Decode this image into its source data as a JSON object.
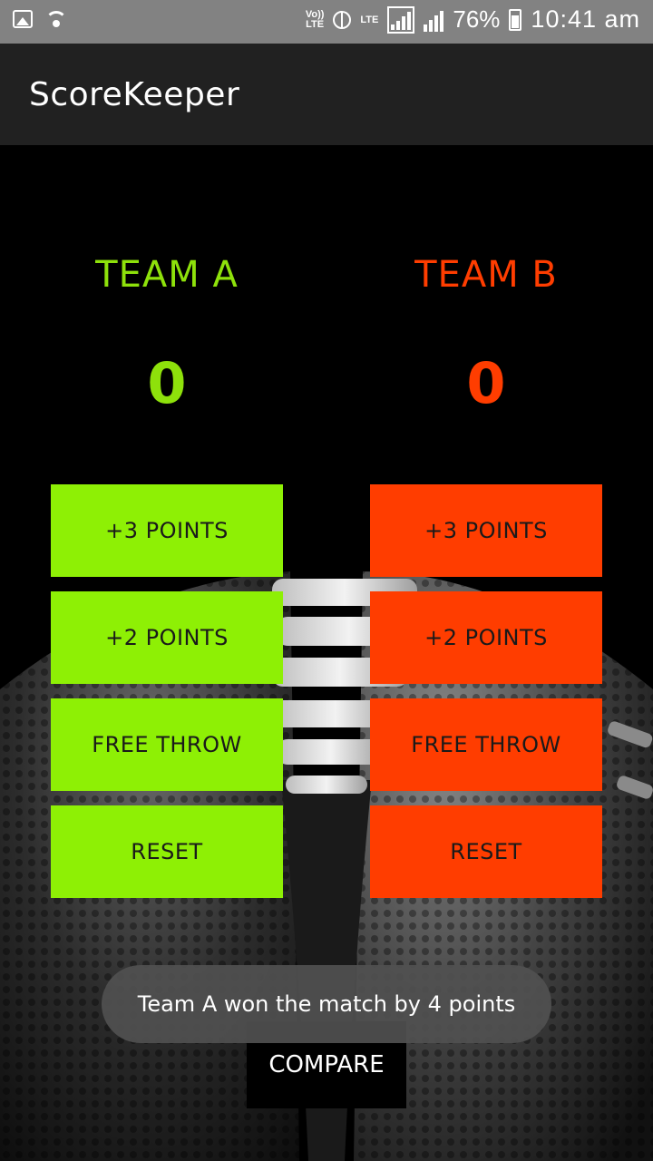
{
  "status_bar": {
    "volte_label": "Vo))\nLTE",
    "lte_label": "LTE",
    "battery_percent": "76%",
    "time": "10:41 am",
    "icons": [
      "image-icon",
      "wifi-icon",
      "volte-icon",
      "globe-icon",
      "lte-signal-icon",
      "signal-icon",
      "battery-icon"
    ]
  },
  "app_bar": {
    "title": "ScoreKeeper"
  },
  "team_a": {
    "name": "TEAM A",
    "score": "0",
    "color": "#8ef005",
    "buttons": {
      "plus3": "+3 POINTS",
      "plus2": "+2 POINTS",
      "free_throw": "FREE THROW",
      "reset": "RESET"
    }
  },
  "team_b": {
    "name": "TEAM B",
    "score": "0",
    "color": "#ff3d00",
    "buttons": {
      "plus3": "+3 POINTS",
      "plus2": "+2 POINTS",
      "free_throw": "FREE THROW",
      "reset": "RESET"
    }
  },
  "compare_button": "COMPARE",
  "toast": "Team A won the match by 4 points"
}
